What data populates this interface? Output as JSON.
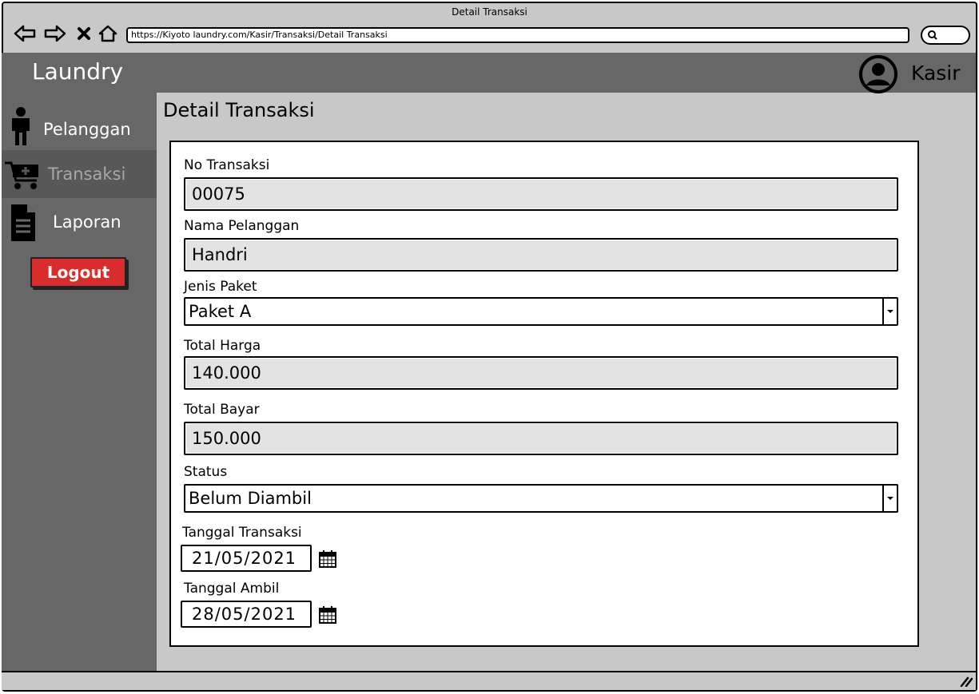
{
  "browser": {
    "title": "Detail Transaksi",
    "url": "https://Kiyoto laundry.com/Kasir/Transaksi/Detail Transaksi"
  },
  "header": {
    "brand": "Laundry",
    "user_name": "Kasir"
  },
  "sidebar": {
    "items": [
      {
        "label": "Pelanggan",
        "icon": "person-icon",
        "active": false
      },
      {
        "label": "Transaksi",
        "icon": "cart-add-icon",
        "active": true
      },
      {
        "label": "Laporan",
        "icon": "document-icon",
        "active": false
      }
    ],
    "logout_label": "Logout"
  },
  "main": {
    "title": "Detail Transaksi",
    "form": {
      "no_transaksi": {
        "label": "No Transaksi",
        "value": "00075"
      },
      "nama_pelanggan": {
        "label": "Nama Pelanggan",
        "value": "Handri"
      },
      "jenis_paket": {
        "label": "Jenis Paket",
        "value": "Paket A"
      },
      "total_harga": {
        "label": "Total Harga",
        "value": "140.000"
      },
      "total_bayar": {
        "label": "Total Bayar",
        "value": "150.000"
      },
      "status": {
        "label": "Status",
        "value": "Belum Diambil"
      },
      "tanggal_transaksi": {
        "label": "Tanggal Transaksi",
        "value": "21/05/2021"
      },
      "tanggal_ambil": {
        "label": "Tanggal Ambil",
        "value": "28/05/2021"
      }
    }
  },
  "colors": {
    "header_bg": "#676767",
    "sidebar_active_bg": "#585858",
    "logout_bg": "#d92c2c",
    "readonly_field_bg": "#e3e3e3"
  }
}
